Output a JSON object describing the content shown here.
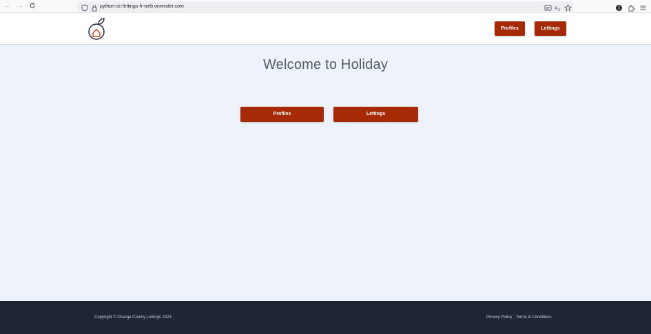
{
  "browser": {
    "url": "python-oc-lettings-fr-web.onrender.com",
    "icons": [
      "back-arrow-icon",
      "forward-arrow-icon",
      "reload-icon",
      "shield-icon",
      "lock-icon",
      "reader-view-icon",
      "translate-icon",
      "bookmark-star-icon",
      "info-icon",
      "extensions-icon",
      "menu-icon"
    ]
  },
  "header": {
    "logo_icon": "orange-house-logo",
    "nav": [
      {
        "label": "Profiles"
      },
      {
        "label": "Lettings"
      }
    ]
  },
  "main": {
    "title": "Welcome to Holiday",
    "buttons": [
      {
        "label": "Profiles"
      },
      {
        "label": "Lettings"
      }
    ]
  },
  "footer": {
    "copyright": "Copyright © Orange County Lettings 2023",
    "privacy_label": "Privacy Policy",
    "separator": " · ",
    "terms_label": "Terms & Conditions"
  },
  "colors": {
    "accent": "#a52a05",
    "page_background": "#eef2fb",
    "footer_background": "#1e2633",
    "title_text": "#4f5a6b"
  }
}
